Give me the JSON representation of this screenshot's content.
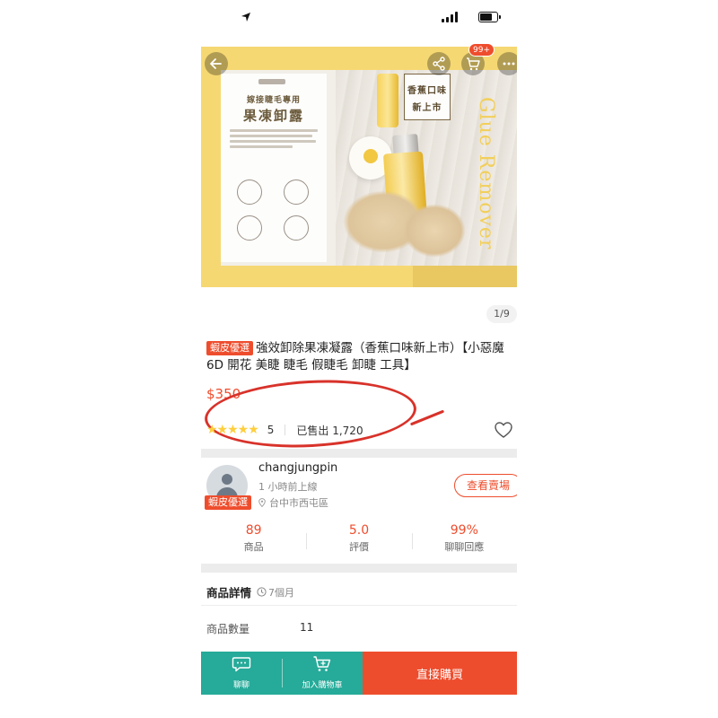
{
  "gallery": {
    "counter": "1/9",
    "card_line1": "嫁接睫毛專用",
    "card_line2": "果凍卸露",
    "tag_line1": "香蕉口味",
    "tag_line2": "新上市",
    "vertical_text": "Glue Remover",
    "cart_badge": "99+"
  },
  "product": {
    "badge": "蝦皮優選",
    "title": "強效卸除果凍凝露（香蕉口味新上市）【小惡魔 6D 開花 美睫 睫毛 假睫毛 卸睫 工具】",
    "price": "$350",
    "stars": "★★★★★",
    "rating_count": "5",
    "sold": "已售出 1,720"
  },
  "seller": {
    "badge": "蝦皮優選",
    "name": "changjungpin",
    "status": "1 小時前上線",
    "location": "台中市西屯區",
    "shop_button": "查看賣場",
    "stats": [
      {
        "value": "89",
        "label": "商品"
      },
      {
        "value": "5.0",
        "label": "評價"
      },
      {
        "value": "99%",
        "label": "聊聊回應"
      }
    ]
  },
  "details": {
    "title": "商品詳情",
    "time": "7個月",
    "qty_label": "商品數量",
    "qty_value": "11"
  },
  "bottom": {
    "chat": "聊聊",
    "add_cart": "加入購物車",
    "buy_now": "直接購買"
  },
  "colors": {
    "accent": "#ee4d2d",
    "teal": "#26aa99",
    "star": "#ffce3d",
    "annotation": "#d8322a"
  }
}
